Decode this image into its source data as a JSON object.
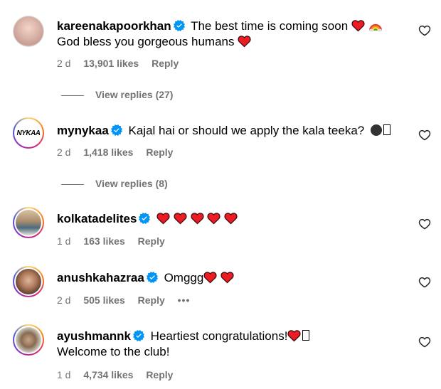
{
  "comments": [
    {
      "username": "kareenakapoorkhan",
      "text1": "The best time is coming soon",
      "text2": "God bless you gorgeous humans",
      "time": "2 d",
      "likes": "13,901 likes",
      "reply": "Reply",
      "view_replies": "View replies (27)"
    },
    {
      "username": "mynykaa",
      "text1": "Kajal hai or should we apply the kala teeka?",
      "avatar_text": "NYKAA",
      "time": "2 d",
      "likes": "1,418 likes",
      "reply": "Reply",
      "view_replies": "View replies (8)"
    },
    {
      "username": "kolkatadelites",
      "time": "1 d",
      "likes": "163 likes",
      "reply": "Reply"
    },
    {
      "username": "anushkahazraa",
      "text1": "Omggg",
      "time": "2 d",
      "likes": "505 likes",
      "reply": "Reply",
      "more": "•••"
    },
    {
      "username": "ayushmannk",
      "text1": "Heartiest congratulations!",
      "text2": "Welcome to the club!",
      "time": "1 d",
      "likes": "4,734 likes",
      "reply": "Reply"
    }
  ],
  "colors": {
    "verified": "#0095f6",
    "heart": "#ed1b24",
    "meta": "#737373"
  }
}
